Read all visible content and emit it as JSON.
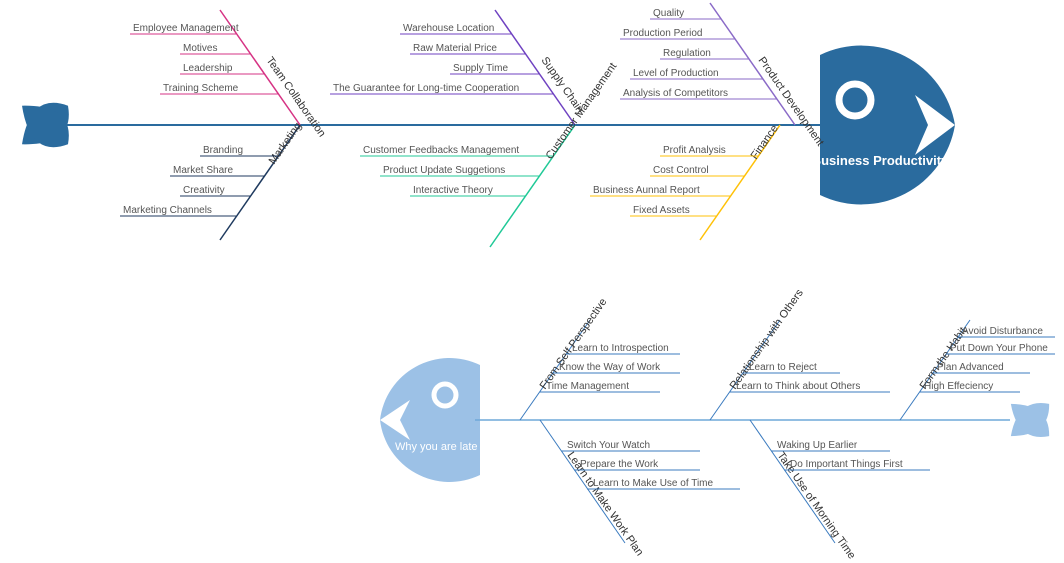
{
  "chart_data": [
    {
      "type": "fishbone",
      "title": "Business Productivity",
      "direction": "right",
      "categories": [
        {
          "name": "Team Collaboration",
          "side": "top",
          "color": "#d63384",
          "items": [
            "Employee Management",
            "Motives",
            "Leadership",
            "Training Scheme"
          ]
        },
        {
          "name": "Supply Chain",
          "side": "top",
          "color": "#6f42c1",
          "items": [
            "Warehouse Location",
            "Raw Material Price",
            "Supply Time",
            "The Guarantee for Long-time Cooperation"
          ]
        },
        {
          "name": "Product Development",
          "side": "top",
          "color": "#6f42c1",
          "items": [
            "Quality",
            "Production Period",
            "Regulation",
            "Level of Production",
            "Analysis of Competitors"
          ]
        },
        {
          "name": "Marketing",
          "side": "bottom",
          "color": "#1f3a5f",
          "items": [
            "Branding",
            "Market Share",
            "Creativity",
            "Marketing Channels"
          ]
        },
        {
          "name": "Customer Management",
          "side": "bottom",
          "color": "#20c997",
          "items": [
            "Customer Feedbacks Management",
            "Product Update Suggetions",
            "Interactive Theory"
          ]
        },
        {
          "name": "Finance",
          "side": "bottom",
          "color": "#ffc107",
          "items": [
            "Profit Analysis",
            "Cost Control",
            "Business Aunnal Report",
            "Fixed Assets"
          ]
        }
      ]
    },
    {
      "type": "fishbone",
      "title": "Why you are late",
      "direction": "left",
      "categories": [
        {
          "name": "From Self Perspective",
          "side": "top",
          "items": [
            "Learn to Introspection",
            "Know the Way of Work",
            "Time Management"
          ]
        },
        {
          "name": "Relationship with Others",
          "side": "top",
          "items": [
            "Learn to Reject",
            "Learn to Think about Others"
          ]
        },
        {
          "name": "Form the Habit",
          "side": "top",
          "items": [
            "Avoid Disturbance",
            "Put Down Your Phone",
            "Plan Advanced",
            "High Effeciency"
          ]
        },
        {
          "name": "Learn to Make Work Plan",
          "side": "bottom",
          "items": [
            "Switch Your Watch",
            "Prepare the Work",
            "Learn to Make Use of Time"
          ]
        },
        {
          "name": "Take Use of Morning Time",
          "side": "bottom",
          "items": [
            "Waking Up Earlier",
            "Do Important Things First"
          ]
        }
      ]
    }
  ]
}
